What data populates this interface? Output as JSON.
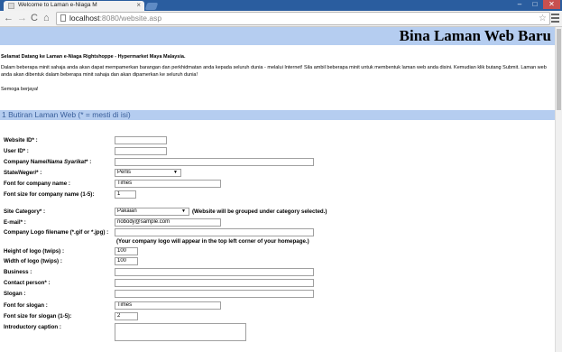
{
  "browser": {
    "tab_title": "Welcome to Laman e-Niaga M",
    "tab_close": "×",
    "url_host": "localhost",
    "url_rest": ":8080/website.asp",
    "window_controls": {
      "minimize": "–",
      "maximize": "□",
      "close": "✕"
    },
    "icons": {
      "back": "←",
      "forward": "→",
      "reload": "C",
      "home": "⌂",
      "star": "☆"
    }
  },
  "page": {
    "banner_title": "Bina Laman Web Baru",
    "welcome": "Selamat Datang ke Laman e-Niaga Rightshoppe - Hypermarket Maya Malaysia.",
    "intro": "Dalam beberapa minit sahaja anda akan dapat mempamerkan barangan dan perkhidmatan anda kepada seluruh dunia - melalui Internet! Sila ambil beberapa minit untuk membentuk laman web anda disini. Kemudian klik butang Submit. Laman web anda akan dibentuk dalam beberapa minit sahaja dan akan dipamerkan ke seluruh dunia!",
    "thanks": "Semoga berjaya!",
    "section_title": "1 Butiran Laman Web (* = mesti di isi)"
  },
  "form": {
    "website_id_label": "Website ID* :",
    "website_id_value": "",
    "user_id_label": "User ID* :",
    "user_id_value": "",
    "company_name_label_a": "Company Name/",
    "company_name_label_b": "Nama Syarikat",
    "company_name_label_c": "* :",
    "company_name_value": "",
    "state_label_a": "State/",
    "state_label_b": "Negeri",
    "state_label_c": "* :",
    "state_value": "Perlis",
    "font_company_label": "Font for company name :",
    "font_company_value": "Times",
    "font_size_company_label": "Font size for company name (1-5):",
    "font_size_company_value": "1",
    "site_category_label": "Site Category* :",
    "site_category_value": "Pakaian",
    "site_category_note": "(Website will be grouped under category selected.)",
    "email_label": "E-mail* :",
    "email_value": "nobody@sample.com",
    "logo_label": "Company Logo filename (*.gif or *.jpg) :",
    "logo_value": "",
    "logo_note": "(Your company logo will appear in the top left corner of your homepage.)",
    "logo_height_label": "Height of logo (twips) :",
    "logo_height_value": "100",
    "logo_width_label": "Width of logo (twips) :",
    "logo_width_value": "100",
    "business_label": "Business :",
    "business_value": "",
    "contact_label": "Contact person* :",
    "contact_value": "",
    "slogan_label": "Slogan :",
    "slogan_value": "",
    "font_slogan_label": "Font for slogan :",
    "font_slogan_value": "Times",
    "font_size_slogan_label": "Font size for slogan (1-5):",
    "font_size_slogan_value": "2",
    "intro_caption_label": "Introductory caption :",
    "intro_caption_value": ""
  }
}
